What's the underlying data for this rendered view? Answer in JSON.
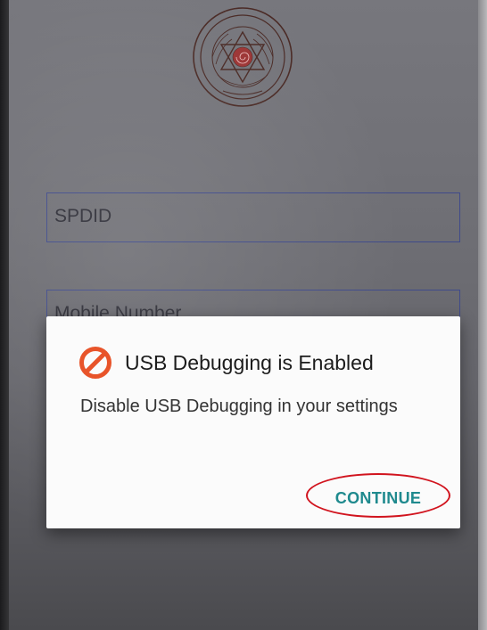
{
  "login": {
    "spdid_placeholder": "SPDID",
    "mobile_placeholder": "Mobile Number"
  },
  "dialog": {
    "title": "USB Debugging is Enabled",
    "message": "Disable USB Debugging in your settings",
    "continue_label": "CONTINUE",
    "icon": "block-icon"
  },
  "colors": {
    "accent": "#1f8a8e",
    "block_icon": "#e8542a",
    "annotation": "#d1141e",
    "field_border": "#3f4a8a"
  }
}
